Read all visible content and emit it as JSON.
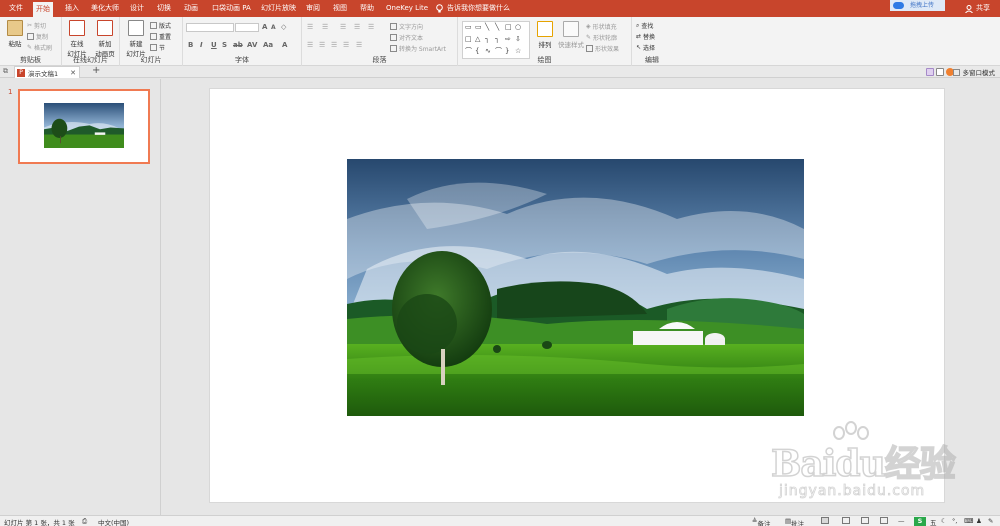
{
  "tabs": [
    "文件",
    "开始",
    "插入",
    "美化大师",
    "设计",
    "切换",
    "动画",
    "口袋动画 PA",
    "幻灯片放映",
    "审阅",
    "视图",
    "帮助",
    "OneKey Lite"
  ],
  "active_tab": "开始",
  "tell_me": "告诉我你想要做什么",
  "upload_label": "拖拽上传",
  "share_label": "共享",
  "ribbon": {
    "paste": "粘贴",
    "cut": "剪切",
    "copy": "复制",
    "format_painter": "格式刷",
    "clipboard_group": "剪贴板",
    "online_slide": "在线\n幻灯片",
    "new_anim_page": "新加\n动画页",
    "online_group": "在线幻灯片",
    "new_slide": "新建\n幻灯片",
    "layout": "版式",
    "reset": "重置",
    "section": "节",
    "slides_group": "幻灯片",
    "font_group": "字体",
    "text_direction": "文字方向",
    "align_text": "对齐文本",
    "convert_smartart": "转换为 SmartArt",
    "paragraph_group": "段落",
    "arrange": "排列",
    "quick_styles": "快速样式",
    "shape_fill": "形状填充",
    "shape_outline": "形状轮廓",
    "shape_effects": "形状效果",
    "drawing_group": "绘图",
    "find": "查找",
    "replace": "替换",
    "select": "选择",
    "editing_group": "编辑",
    "font_buttons": [
      "B",
      "I",
      "U",
      "S",
      "ab",
      "AV",
      "Aa",
      "A"
    ]
  },
  "document_tab": "演示文稿1",
  "multi_window": "多窗口模式",
  "slide_number": "1",
  "status": {
    "slide_info": "幻灯片 第 1 张，共 1 张",
    "language": "中文(中国)",
    "notes": "备注",
    "comments": "批注"
  },
  "watermark": {
    "main": "Baidu经验",
    "sub": "jingyan.baidu.com"
  },
  "colors": {
    "accent": "#c8452c",
    "thumb_border": "#f07a52"
  }
}
